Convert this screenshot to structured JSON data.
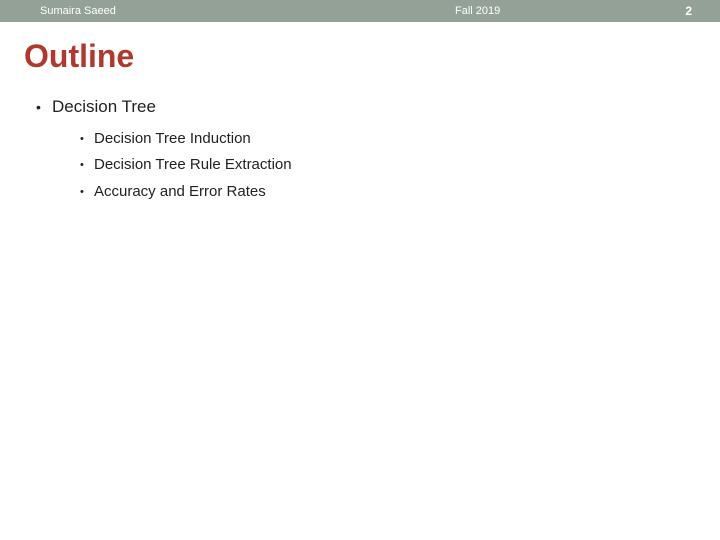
{
  "header": {
    "author": "Sumaira Saeed",
    "term": "Fall 2019",
    "page": "2"
  },
  "title": "Outline",
  "outline": {
    "heading": "Decision Tree",
    "items": [
      "Decision Tree Induction",
      "Decision Tree Rule Extraction",
      "Accuracy and Error Rates"
    ]
  }
}
